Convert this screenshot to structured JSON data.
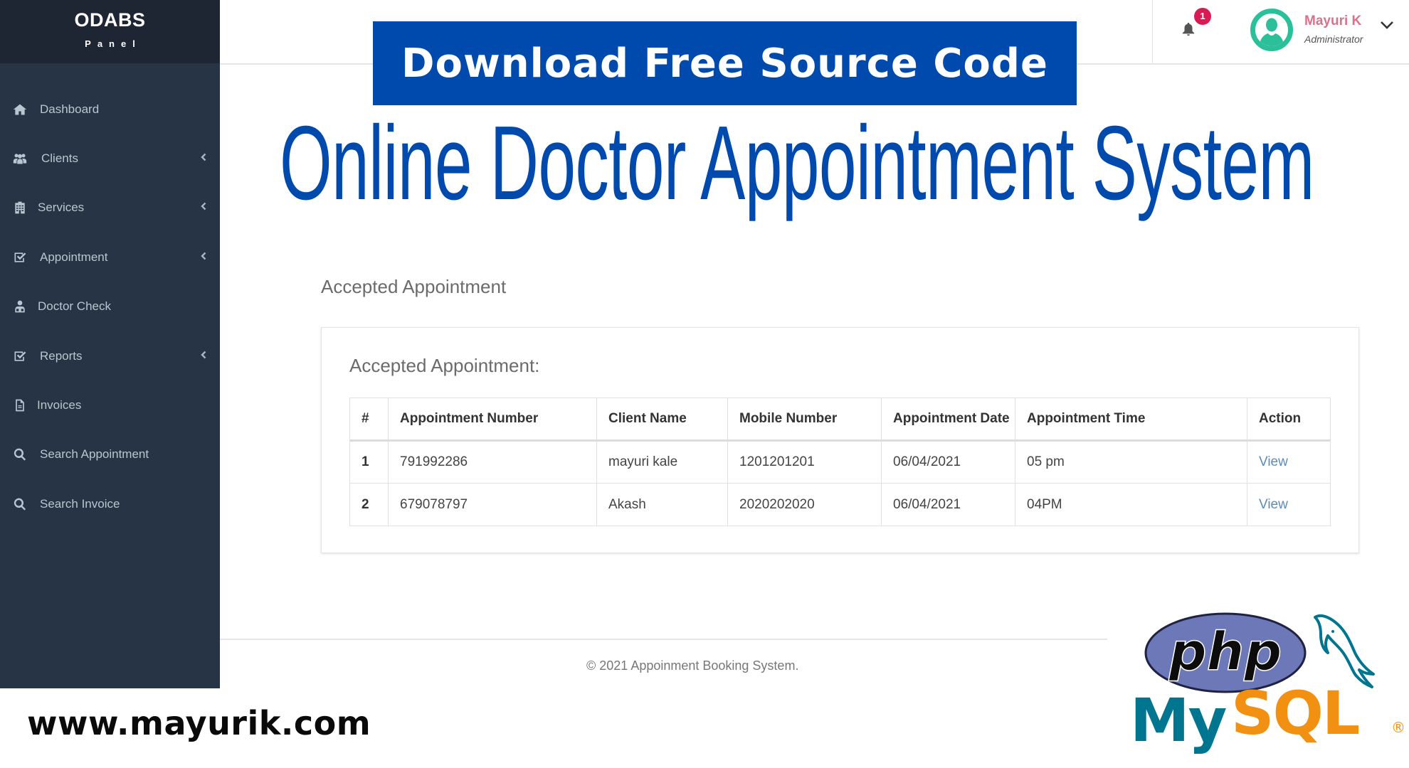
{
  "brand": {
    "name": "ODABS",
    "subtitle": "Panel"
  },
  "sidebar": {
    "items": [
      {
        "label": "Dashboard",
        "icon": "home-icon",
        "expandable": false
      },
      {
        "label": "Clients",
        "icon": "users-icon",
        "expandable": true
      },
      {
        "label": "Services",
        "icon": "building-icon",
        "expandable": true
      },
      {
        "label": "Appointment",
        "icon": "check-square-icon",
        "expandable": true
      },
      {
        "label": "Doctor Check",
        "icon": "doctor-icon",
        "expandable": false
      },
      {
        "label": "Reports",
        "icon": "check-square-icon",
        "expandable": true
      },
      {
        "label": "Invoices",
        "icon": "file-icon",
        "expandable": false
      },
      {
        "label": "Search Appointment",
        "icon": "search-icon",
        "expandable": false
      },
      {
        "label": "Search Invoice",
        "icon": "search-icon",
        "expandable": false
      }
    ]
  },
  "header": {
    "notification_count": "1",
    "user": {
      "name": "Mayuri K",
      "role": "Administrator"
    }
  },
  "promo": {
    "banner_text": "Download Free Source Code",
    "title": "Online Doctor Appointment System",
    "site_url": "www.mayurik.com",
    "tech_logos": [
      "php",
      "MySQL"
    ]
  },
  "page": {
    "heading": "Accepted Appointment",
    "card_title": "Accepted Appointment:",
    "table": {
      "columns": [
        "#",
        "Appointment Number",
        "Client Name",
        "Mobile Number",
        "Appointment Date",
        "Appointment Time",
        "Action"
      ],
      "rows": [
        {
          "index": "1",
          "appointment_number": "791992286",
          "client_name": "mayuri kale",
          "mobile": "1201201201",
          "date": "06/04/2021",
          "time": "05 pm",
          "action": "View"
        },
        {
          "index": "2",
          "appointment_number": "679078797",
          "client_name": "Akash",
          "mobile": "2020202020",
          "date": "06/04/2021",
          "time": "04PM",
          "action": "View"
        }
      ]
    }
  },
  "footer": {
    "text": "© 2021 Appoinment Booking System."
  },
  "colors": {
    "sidebar_bg": "#263446",
    "brand_bg": "#1e2533",
    "promo_blue": "#004aad",
    "badge": "#d81b52",
    "avatar": "#2bbf9a",
    "user_name": "#d9728a",
    "link": "#5b8cba",
    "mysql_blue": "#00758f",
    "mysql_orange": "#f29111",
    "php_purple": "#6c78b7"
  }
}
